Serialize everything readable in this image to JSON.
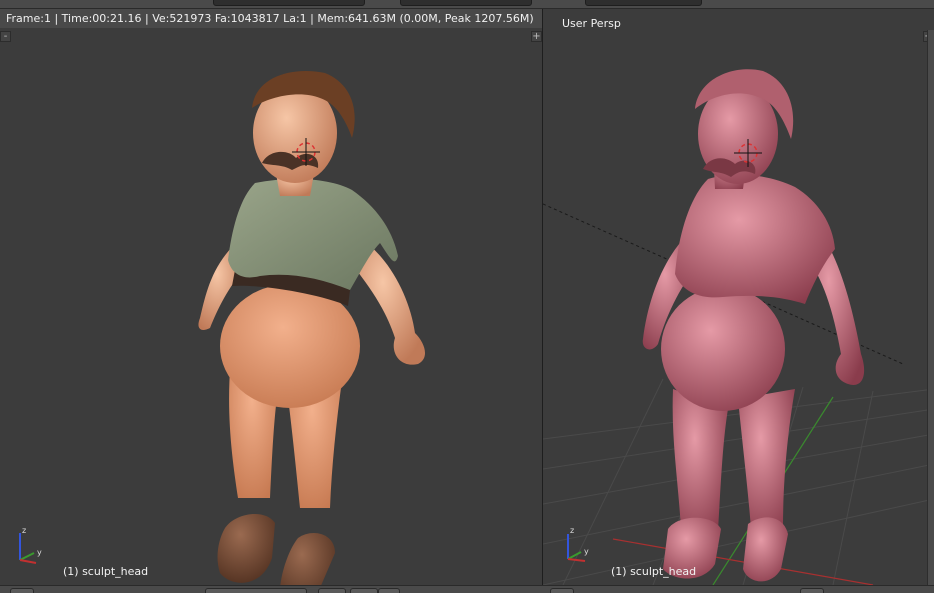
{
  "infobar": {
    "stats": "Frame:1 | Time:00:21.16 | Ve:521973 Fa:1043817 La:1 | Mem:641.63M (0.00M, Peak 1207.56M)"
  },
  "viewport_right": {
    "view_name": "User Persp",
    "object_label": "(1) sculpt_head"
  },
  "viewport_left": {
    "object_label": "(1) sculpt_head"
  },
  "icons": {
    "corner_plus": "+",
    "corner_minus": "-"
  },
  "colors": {
    "left_model_shirt": "#7d8a6e",
    "left_model_skin": "#e5a07d",
    "left_model_hair": "#6b3f24",
    "right_model_matcap": "#c9707f",
    "viewport_bg": "#3c3c3c",
    "grid_line": "#474747",
    "axis_x": "#b03030",
    "axis_y": "#3a8a2e"
  }
}
